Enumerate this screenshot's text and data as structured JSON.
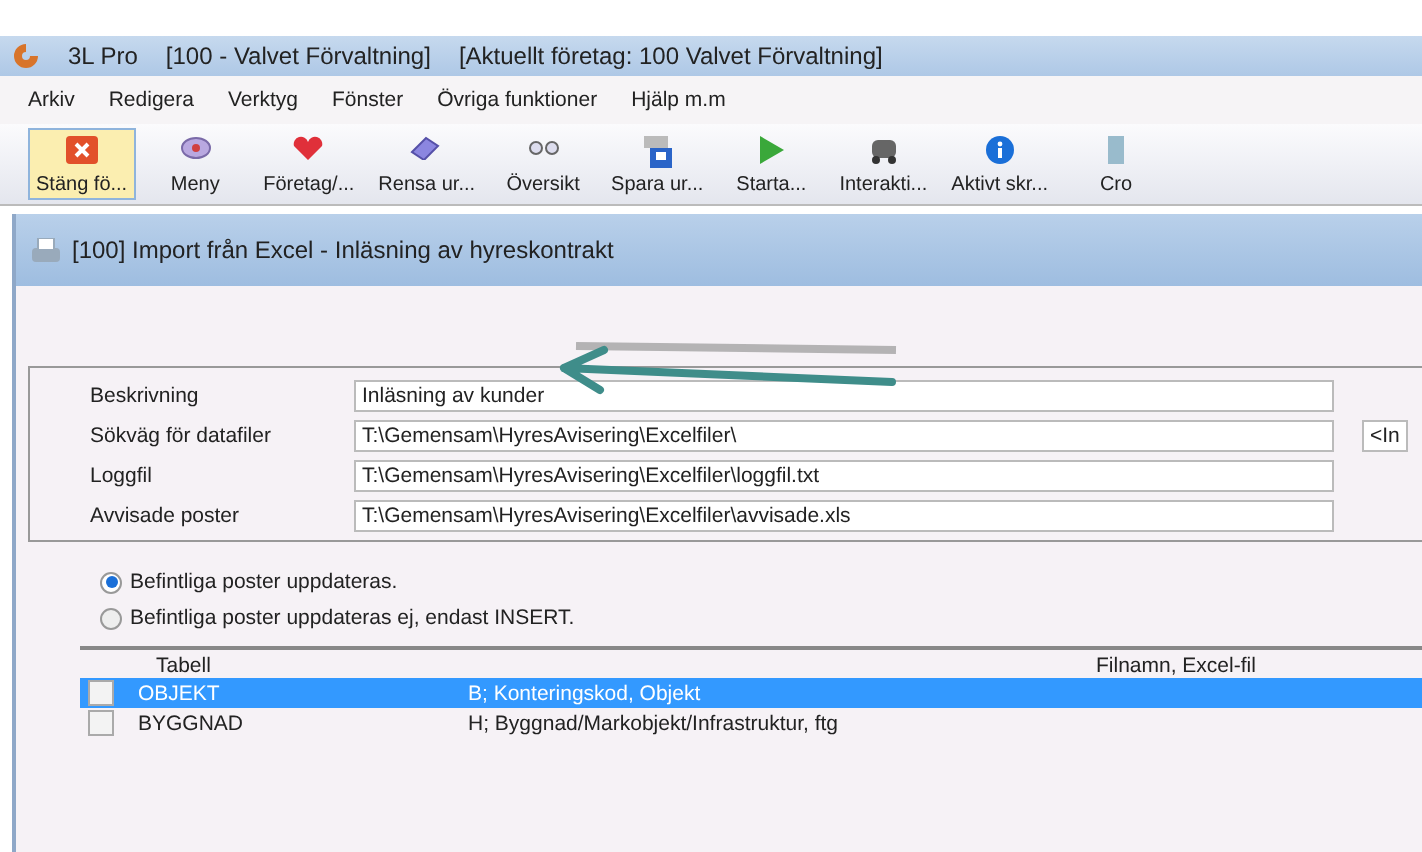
{
  "app_window": {
    "title_parts": [
      "3L Pro",
      "[100 - Valvet Förvaltning]",
      "[Aktuellt företag: 100 Valvet Förvaltning]"
    ]
  },
  "menu": [
    "Arkiv",
    "Redigera",
    "Verktyg",
    "Fönster",
    "Övriga funktioner",
    "Hjälp m.m"
  ],
  "toolbar": [
    {
      "label": "Stäng fö...",
      "kind": "close",
      "selected": true
    },
    {
      "label": "Meny",
      "kind": "menu",
      "selected": false
    },
    {
      "label": "Företag/...",
      "kind": "heart",
      "selected": false
    },
    {
      "label": "Rensa ur...",
      "kind": "eraser",
      "selected": false
    },
    {
      "label": "Översikt",
      "kind": "glasses",
      "selected": false
    },
    {
      "label": "Spara ur...",
      "kind": "save",
      "selected": false
    },
    {
      "label": "Starta...",
      "kind": "play",
      "selected": false
    },
    {
      "label": "Interakti...",
      "kind": "car",
      "selected": false
    },
    {
      "label": "Aktivt skr...",
      "kind": "info",
      "selected": false
    },
    {
      "label": "Cro",
      "kind": "doc",
      "selected": false
    }
  ],
  "dialog": {
    "title": "[100]  Import från Excel - Inläsning av hyreskontrakt",
    "fields": [
      {
        "label": "Beskrivning",
        "value": "Inläsning av kunder"
      },
      {
        "label": "Sökväg för datafiler",
        "value": "T:\\Gemensam\\HyresAvisering\\Excelfiler\\",
        "button": "<In"
      },
      {
        "label": "Loggfil",
        "value": "T:\\Gemensam\\HyresAvisering\\Excelfiler\\loggfil.txt"
      },
      {
        "label": "Avvisade poster",
        "value": "T:\\Gemensam\\HyresAvisering\\Excelfiler\\avvisade.xls"
      }
    ],
    "options": [
      {
        "label": "Befintliga poster uppdateras.",
        "selected": true
      },
      {
        "label": "Befintliga poster uppdateras ej, endast INSERT.",
        "selected": false
      }
    ],
    "table": {
      "columns": [
        "Tabell",
        "Filnamn, Excel-fil"
      ],
      "rows": [
        {
          "table": "OBJEKT",
          "description": "B; Konteringskod, Objekt",
          "checked": false,
          "selected": true
        },
        {
          "table": "BYGGNAD",
          "description": "H; Byggnad/Markobjekt/Infrastruktur, ftg",
          "checked": false,
          "selected": false
        }
      ]
    }
  }
}
